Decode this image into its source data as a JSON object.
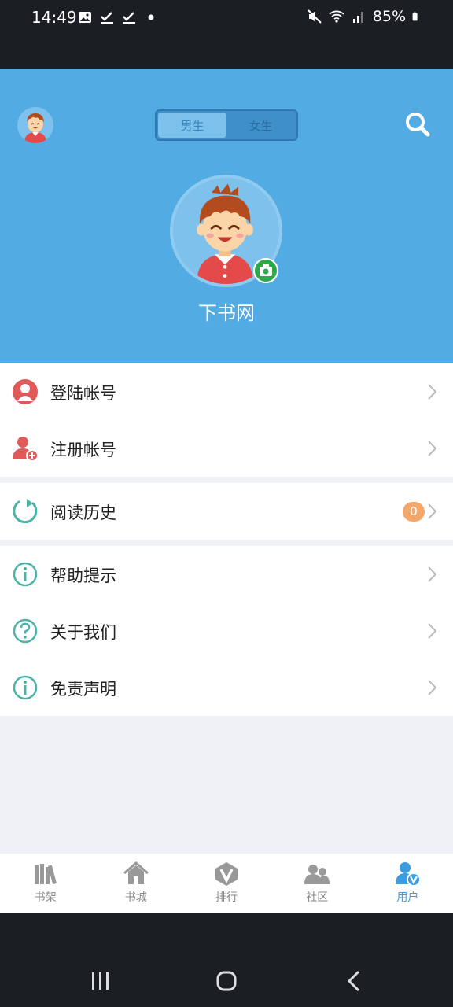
{
  "status_bar": {
    "time": "14:49",
    "battery": "85%",
    "left_icons": [
      "image-icon",
      "check-icon",
      "check-icon",
      "dot-icon"
    ],
    "right_icons": [
      "mute-icon",
      "wifi-icon",
      "signal-icon",
      "battery-icon"
    ]
  },
  "header": {
    "gender_tabs": [
      {
        "label": "男生",
        "active": true
      },
      {
        "label": "女生",
        "active": false
      }
    ],
    "site_name": "下书网",
    "accent": "#52abe3"
  },
  "menu": {
    "account": [
      {
        "label": "登陆帐号",
        "icon": "user-icon"
      },
      {
        "label": "注册帐号",
        "icon": "add-user-icon"
      }
    ],
    "history": {
      "label": "阅读历史",
      "icon": "refresh-icon",
      "count": "0"
    },
    "info": [
      {
        "label": "帮助提示",
        "icon": "info-icon"
      },
      {
        "label": "关于我们",
        "icon": "question-icon"
      },
      {
        "label": "免责声明",
        "icon": "info-icon"
      }
    ]
  },
  "tabs": [
    {
      "label": "书架",
      "icon": "bookshelf-icon",
      "active": false
    },
    {
      "label": "书城",
      "icon": "home-icon",
      "active": false
    },
    {
      "label": "排行",
      "icon": "rank-icon",
      "active": false
    },
    {
      "label": "社区",
      "icon": "community-icon",
      "active": false
    },
    {
      "label": "用户",
      "icon": "user-v-icon",
      "active": true
    }
  ]
}
